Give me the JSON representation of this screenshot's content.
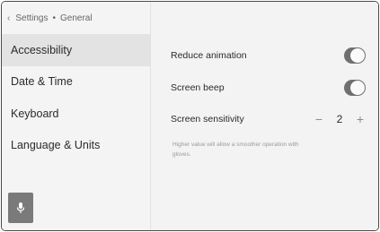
{
  "breadcrumb": {
    "parent": "Settings",
    "separator": "•",
    "current": "General"
  },
  "sidebar": {
    "items": [
      {
        "label": "Accessibility",
        "active": true
      },
      {
        "label": "Date & Time",
        "active": false
      },
      {
        "label": "Keyboard",
        "active": false
      },
      {
        "label": "Language & Units",
        "active": false
      }
    ]
  },
  "settings": {
    "reduce_animation": {
      "label": "Reduce animation",
      "on": true
    },
    "screen_beep": {
      "label": "Screen beep",
      "on": true
    },
    "screen_sensitivity": {
      "label": "Screen sensitivity",
      "value": "2",
      "minus": "−",
      "plus": "+",
      "hint": "Higher value will allow a smoother operation with gloves."
    }
  },
  "icons": {
    "back": "chevron-left-icon",
    "voice": "microphone-icon"
  },
  "colors": {
    "active_item": "#e3e3e3",
    "toggle_on": "#6f6f6f",
    "voice_button": "#7a7a7a"
  }
}
